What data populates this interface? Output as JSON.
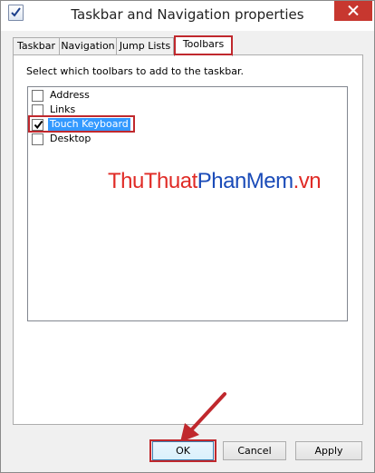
{
  "window": {
    "title": "Taskbar and Navigation properties",
    "icon": "checkbox-document-icon",
    "close_icon": "close-icon"
  },
  "tabs": [
    {
      "label": "Taskbar",
      "active": false
    },
    {
      "label": "Navigation",
      "active": false
    },
    {
      "label": "Jump Lists",
      "active": false
    },
    {
      "label": "Toolbars",
      "active": true
    }
  ],
  "panel": {
    "instruction": "Select which toolbars to add to the taskbar.",
    "toolbars": [
      {
        "label": "Address",
        "checked": false,
        "selected": false
      },
      {
        "label": "Links",
        "checked": false,
        "selected": false
      },
      {
        "label": "Touch Keyboard",
        "checked": true,
        "selected": true
      },
      {
        "label": "Desktop",
        "checked": false,
        "selected": false
      }
    ]
  },
  "watermark": {
    "part1": "Thu",
    "part2": "Thuat",
    "part3": "PhanMem",
    "part4": ".vn"
  },
  "buttons": {
    "ok": "OK",
    "cancel": "Cancel",
    "apply": "Apply"
  },
  "colors": {
    "annotation": "#c0282d",
    "selection": "#3399ff",
    "close_button": "#c7372f"
  }
}
